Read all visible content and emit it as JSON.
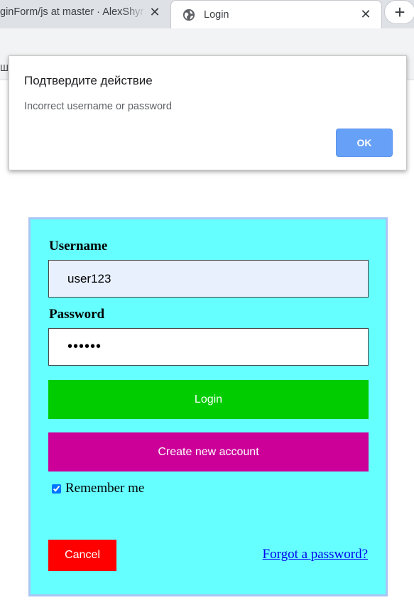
{
  "browser": {
    "tabs": [
      {
        "title": "ginForm/js at master · AlexShyr",
        "close": "✕"
      },
      {
        "title": "Login",
        "close": "✕"
      }
    ],
    "new_tab": "+",
    "bookmark_stub": "Ш"
  },
  "dialog": {
    "title": "Подтвердите действие",
    "message": "Incorrect username or password",
    "ok_label": "OK"
  },
  "form": {
    "username_label": "Username",
    "username_value": "user123",
    "password_label": "Password",
    "password_value": "••••••",
    "login_label": "Login",
    "create_label": "Create new account",
    "remember_label": "Remember me",
    "remember_checked": true,
    "cancel_label": "Cancel",
    "forgot_label": "Forgot a password?"
  },
  "colors": {
    "form_bg": "#66ffff",
    "login_btn": "#00cc00",
    "create_btn": "#cc0099",
    "cancel_btn": "#ff0000",
    "ok_btn": "#66a0f7"
  }
}
